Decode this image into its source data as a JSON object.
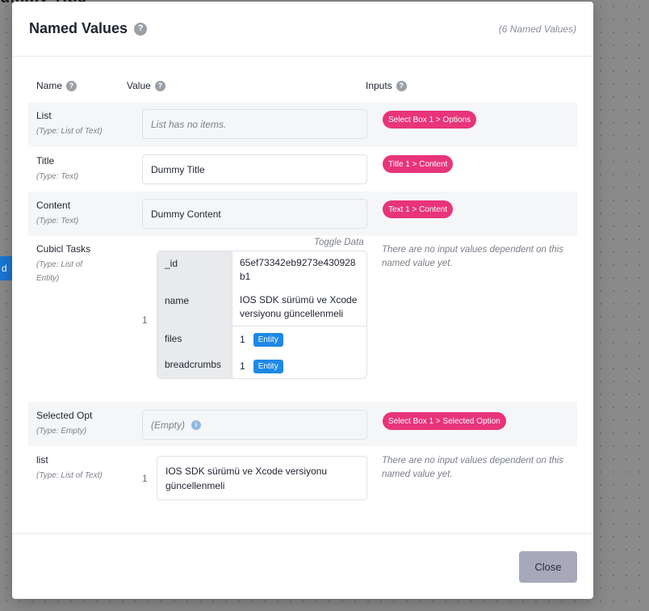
{
  "background": {
    "title": "ummy Title",
    "chip": "d Ta"
  },
  "modal": {
    "title": "Named Values",
    "count": "(6 Named Values)",
    "columns": {
      "name": "Name",
      "value": "Value",
      "inputs": "Inputs"
    },
    "help_glyph": "?",
    "close_label": "Close"
  },
  "rows": [
    {
      "name": "List",
      "type": "(Type: List of Text)",
      "value": "List has no items.",
      "input": "Select Box 1 > Options"
    },
    {
      "name": "Title",
      "type": "(Type: Text)",
      "value": "Dummy Title",
      "input": "Title 1 > Content"
    },
    {
      "name": "Content",
      "type": "(Type: Text)",
      "value": "Dummy Content",
      "input": "Text 1 > Content"
    },
    {
      "name": "Cubicl Tasks",
      "type": "(Type: List of Entity)",
      "toggle": "Toggle Data",
      "index": "1",
      "entity": {
        "id_key": "_id",
        "id_value": "65ef73342eb9273e430928b1",
        "name_key": "name",
        "name_value": "IOS SDK sürümü ve Xcode versiyonu güncellenmeli",
        "files_key": "files",
        "files_count": "1",
        "breadcrumbs_key": "breadcrumbs",
        "breadcrumbs_count": "1",
        "badge": "Entity"
      },
      "no_input": "There are no input values dependent on this named value yet."
    },
    {
      "name": "Selected Opt",
      "type": "(Type: Empty)",
      "value": "(Empty)",
      "info_glyph": "i",
      "input": "Select Box 1 > Selected Option"
    },
    {
      "name": "list",
      "type": "(Type: List of Text)",
      "index": "1",
      "value": "IOS SDK sürümü ve Xcode versiyonu güncellenmeli",
      "no_input": "There are no input values dependent on this named value yet."
    }
  ]
}
